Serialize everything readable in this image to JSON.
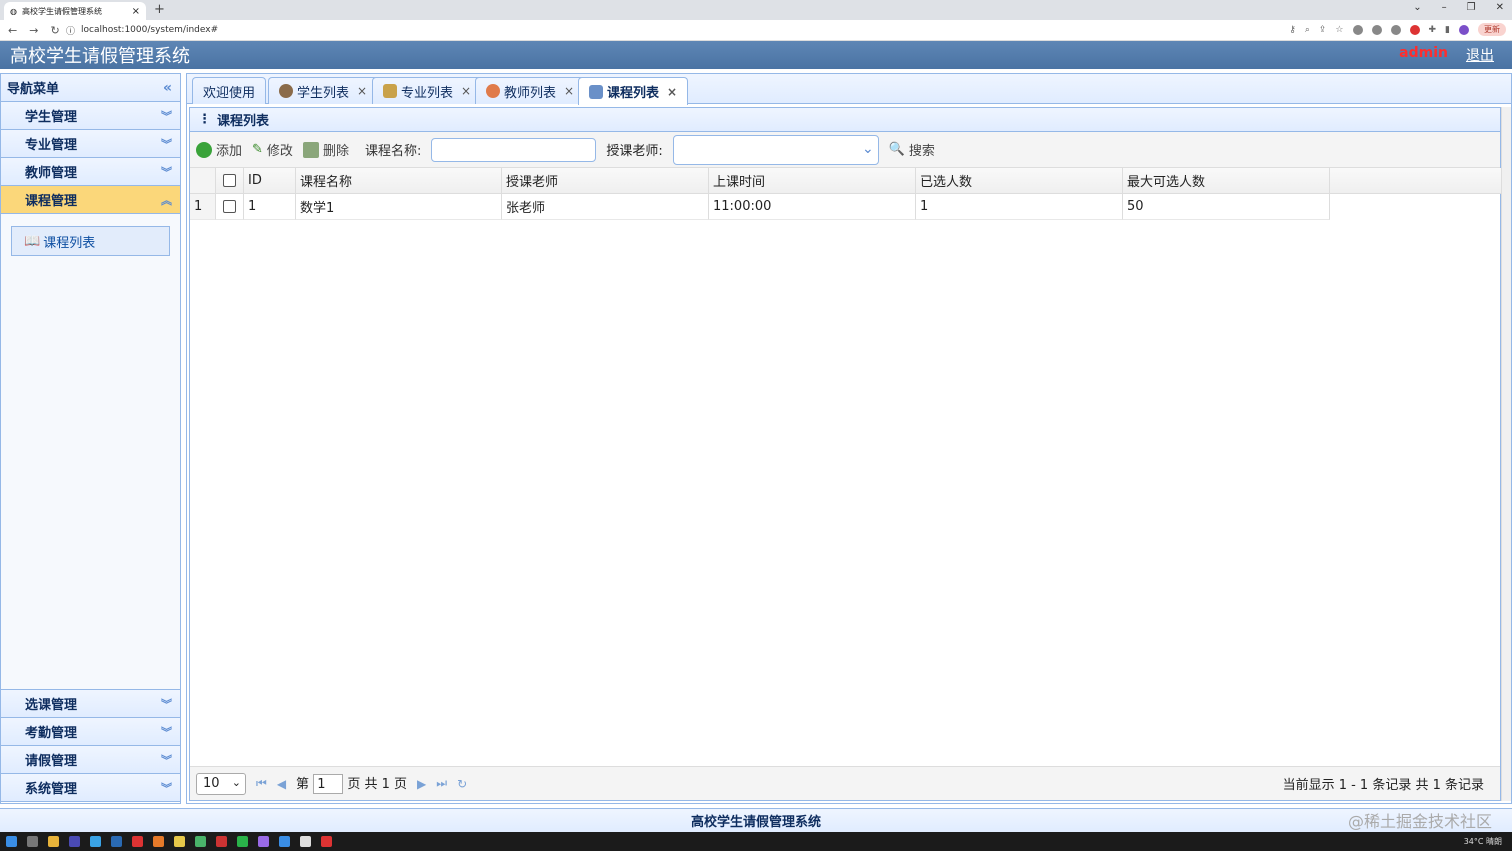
{
  "browser": {
    "tab_title": "高校学生请假管理系统",
    "url": "localhost:1000/system/index#",
    "update_label": "更新"
  },
  "app": {
    "title": "高校学生请假管理系统",
    "user": "admin",
    "logout": "退出",
    "footer": "高校学生请假管理系统"
  },
  "sidebar": {
    "title": "导航菜单",
    "items_top": [
      {
        "label": "学生管理"
      },
      {
        "label": "专业管理"
      },
      {
        "label": "教师管理"
      },
      {
        "label": "课程管理"
      }
    ],
    "active_sub": "课程列表",
    "items_bottom": [
      {
        "label": "选课管理"
      },
      {
        "label": "考勤管理"
      },
      {
        "label": "请假管理"
      },
      {
        "label": "系统管理"
      }
    ]
  },
  "tabs": [
    {
      "label": "欢迎使用"
    },
    {
      "label": "学生列表"
    },
    {
      "label": "专业列表"
    },
    {
      "label": "教师列表"
    },
    {
      "label": "课程列表"
    }
  ],
  "panel": {
    "title": "课程列表",
    "toolbar": {
      "add": "添加",
      "edit": "修改",
      "delete": "删除",
      "course_name_label": "课程名称:",
      "teacher_label": "授课老师:",
      "search": "搜索"
    }
  },
  "grid": {
    "columns": [
      "ID",
      "课程名称",
      "授课老师",
      "上课时间",
      "已选人数",
      "最大可选人数"
    ],
    "rows": [
      {
        "num": "1",
        "id": "1",
        "name": "数学1",
        "teacher": "张老师",
        "time": "11:00:00",
        "selected": "1",
        "max": "50"
      }
    ]
  },
  "pager": {
    "page_size": "10",
    "page_prefix": "第",
    "page_value": "1",
    "page_suffix": "页 共 1 页",
    "info": "当前显示 1 - 1 条记录 共 1 条记录"
  },
  "watermark": "@稀土掘金技术社区",
  "taskbar": {
    "weather": "34°C 晴朗"
  },
  "colors": {
    "header": "#4a73a3",
    "accent_border": "#95b8e7",
    "active_menu": "#fbd77a",
    "admin": "#ff2d2d"
  }
}
